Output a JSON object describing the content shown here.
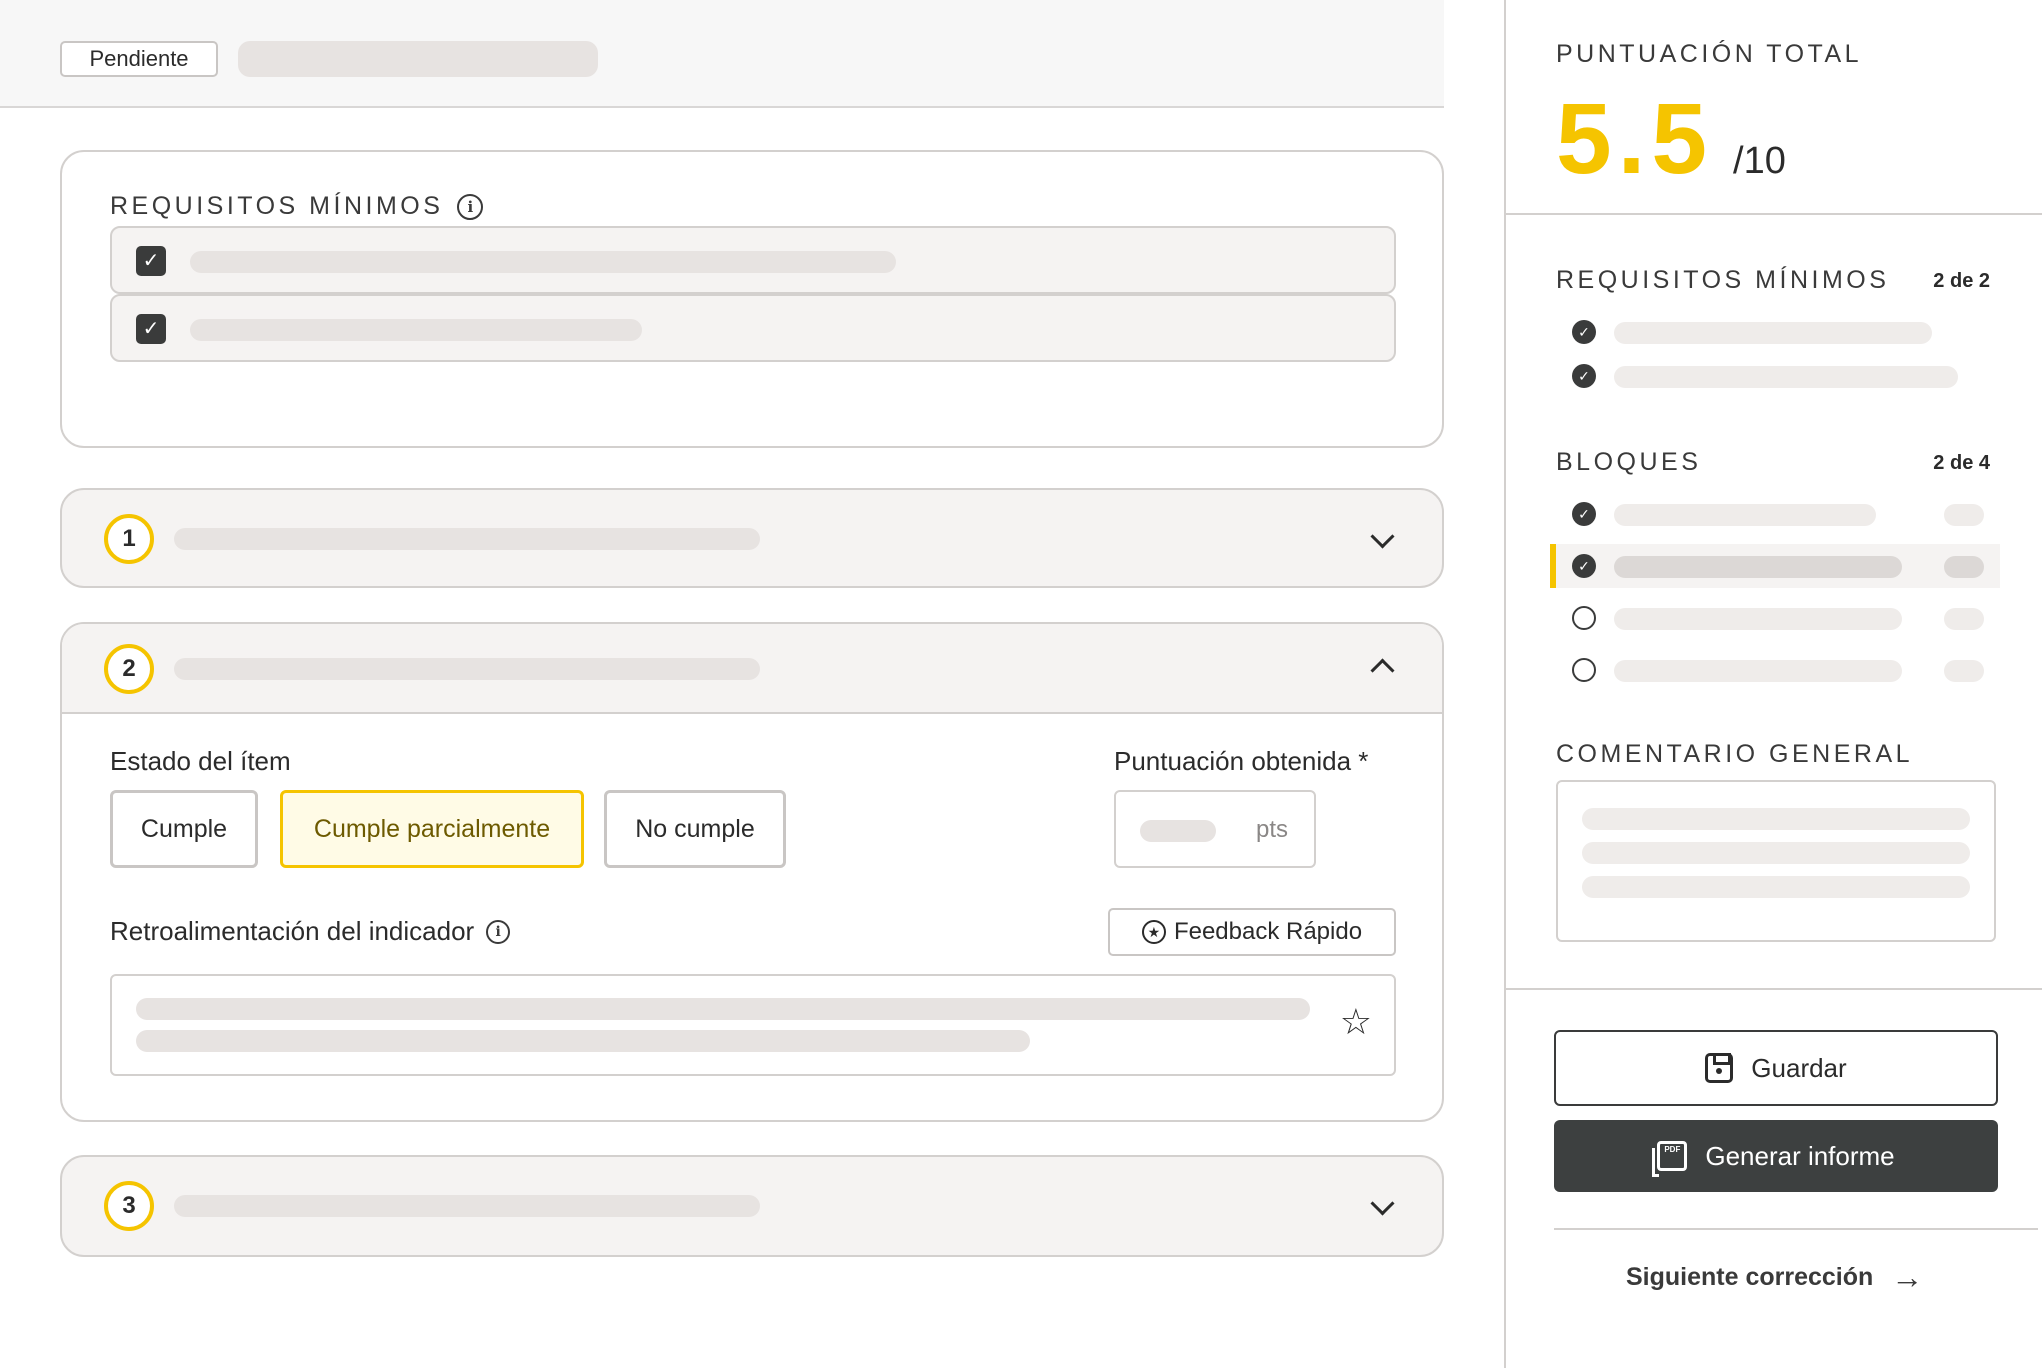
{
  "status": {
    "label": "Pendiente"
  },
  "requirements": {
    "title": "REQUISITOS MÍNIMOS",
    "items": [
      {
        "checked": true
      },
      {
        "checked": true
      }
    ]
  },
  "blocks": [
    {
      "number": "1",
      "expanded": false
    },
    {
      "number": "2",
      "expanded": true
    },
    {
      "number": "3",
      "expanded": false
    }
  ],
  "item_form": {
    "estado_label": "Estado del ítem",
    "options": [
      "Cumple",
      "Cumple parcialmente",
      "No cumple"
    ],
    "selected": "Cumple parcialmente",
    "puntuacion_label": "Puntuación obtenida *",
    "pts_unit": "pts",
    "retro_label": "Retroalimentación del indicador",
    "feedback_button": "Feedback Rápido"
  },
  "summary": {
    "total_title": "PUNTUACIÓN TOTAL",
    "score": "5.5",
    "score_max": "/10",
    "requisitos_title": "REQUISITOS MÍNIMOS",
    "requisitos_count": "2 de 2",
    "bloques_title": "BLOQUES",
    "bloques_count": "2 de 4",
    "comentario_title": "COMENTARIO GENERAL"
  },
  "actions": {
    "save": "Guardar",
    "report": "Generar informe",
    "next": "Siguiente corrección"
  },
  "colors": {
    "accent": "#f5c400",
    "dark": "#3d4040"
  }
}
